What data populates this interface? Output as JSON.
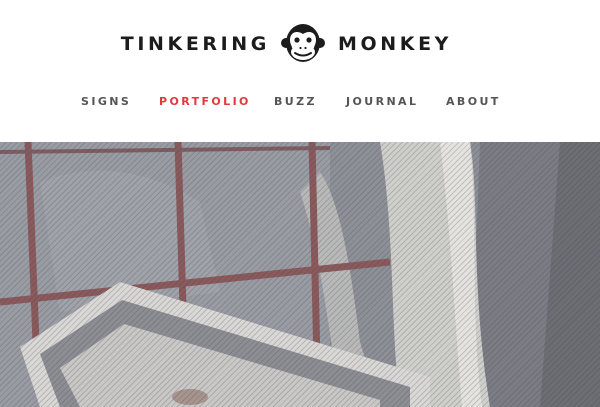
{
  "brand": {
    "name_left": "TINKERING",
    "name_right": "MONKEY",
    "logo_icon": "monkey-face-icon"
  },
  "nav": {
    "items": [
      {
        "label": "SIGNS",
        "active": false
      },
      {
        "label": "PORTFOLIO",
        "active": true
      },
      {
        "label": "BUZZ",
        "active": false
      },
      {
        "label": "JOURNAL",
        "active": false
      },
      {
        "label": "ABOUT",
        "active": false
      }
    ]
  },
  "hero": {
    "overlay": "diagonal-stripes",
    "colors": {
      "overlay": "#8f8f94",
      "window_frame": "#8a5a5c",
      "accent_nav": "#e0393e"
    }
  }
}
